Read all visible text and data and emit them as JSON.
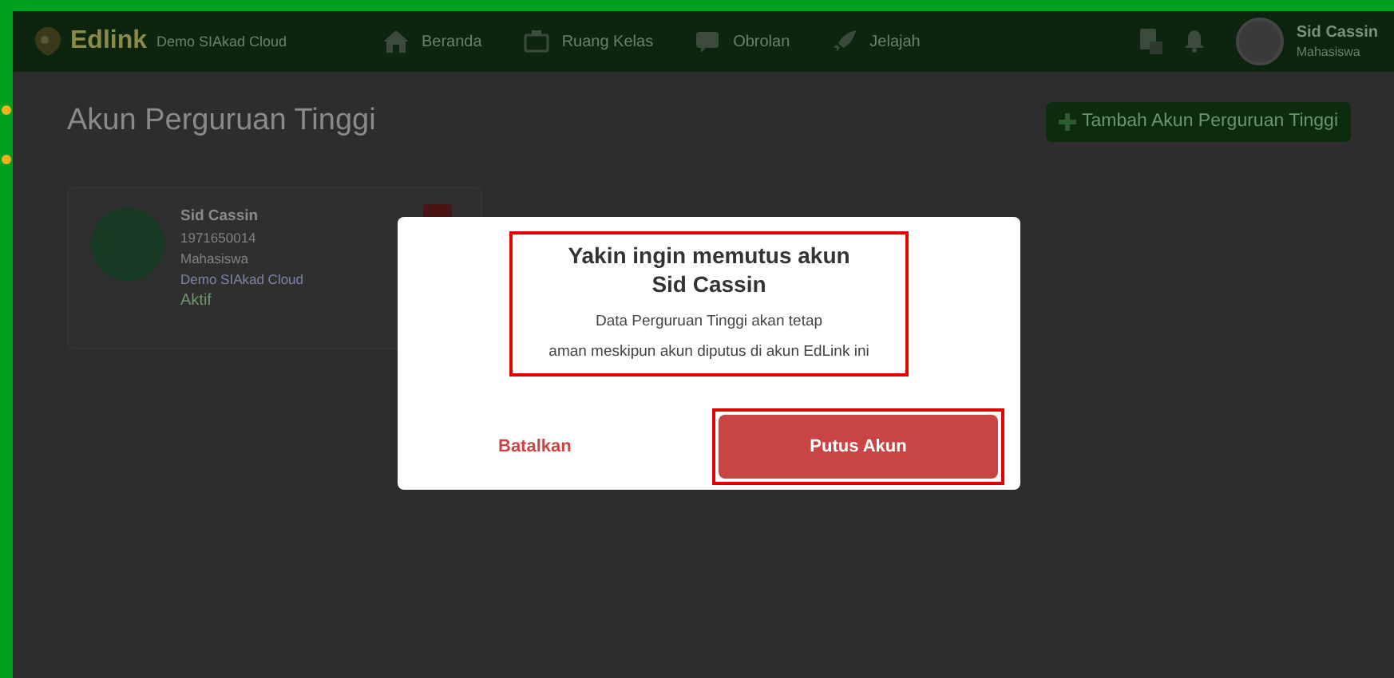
{
  "header": {
    "brand": "Edlink",
    "institution": "Demo SIAkad Cloud",
    "nav": [
      {
        "label": "Beranda"
      },
      {
        "label": "Ruang Kelas"
      },
      {
        "label": "Obrolan"
      },
      {
        "label": "Jelajah"
      }
    ],
    "user": {
      "name": "Sid Cassin",
      "role": "Mahasiswa"
    }
  },
  "page": {
    "title": "Akun Perguruan Tinggi",
    "add_button": "Tambah Akun Perguruan Tinggi"
  },
  "account_card": {
    "name": "Sid Cassin",
    "id": "1971650014",
    "role": "Mahasiswa",
    "institution": "Demo SIAkad Cloud",
    "status": "Aktif"
  },
  "dialog": {
    "title_lines": [
      "Yakin ingin memutus akun",
      "Sid Cassin"
    ],
    "body_lines": [
      "Data Perguruan Tinggi akan tetap",
      "aman meskipun akun diputus di akun EdLink ini"
    ],
    "message_annotated": true,
    "cancel_button": "Batalkan",
    "confirm_button": "Putus Akun",
    "confirm_annotated": true
  }
}
